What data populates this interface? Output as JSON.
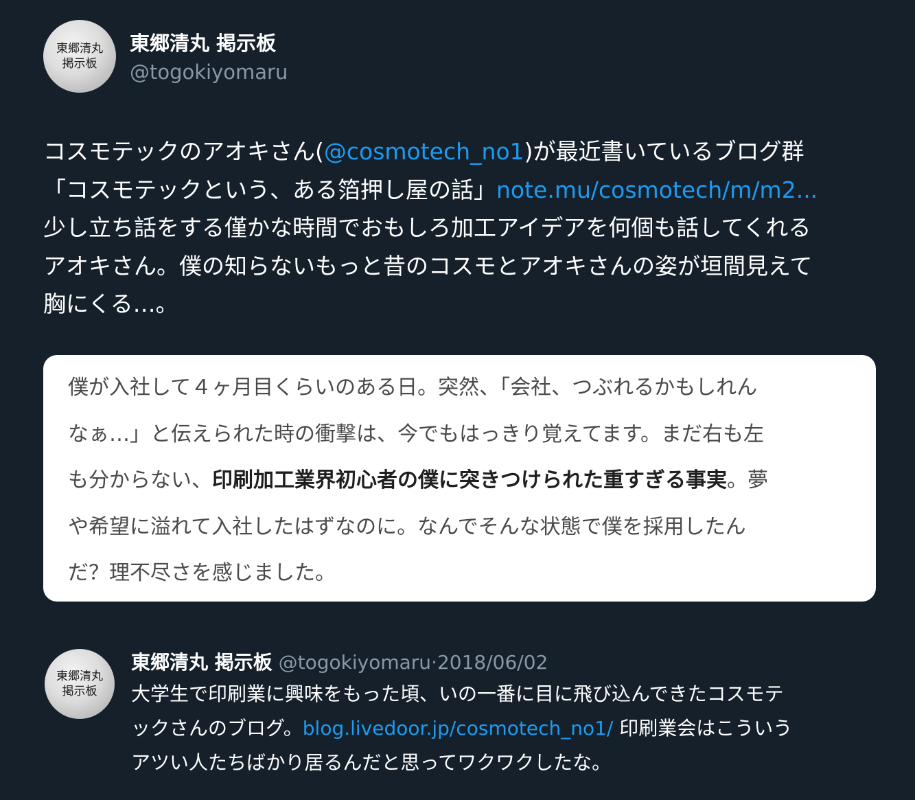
{
  "tweet": {
    "avatar_text": [
      "東郷清丸",
      "掲示板"
    ],
    "display_name": "東郷清丸 掲示板",
    "handle": "@togokiyomaru",
    "lines": [
      {
        "pre": "コスモテックのアオキさん(",
        "link": "@cosmotech_no1",
        "post": ")が最近書いているブログ群"
      },
      {
        "pre": "「コスモテックという、ある箔押し屋の話」",
        "link": "note.mu/cosmotech/m/m2...",
        "post": ""
      },
      {
        "pre": "少し立ち話をする僅かな時間でおもしろ加工アイデアを何個も話してくれる",
        "link": "",
        "post": ""
      },
      {
        "pre": "アオキさん。僕の知らないもっと昔のコスモとアオキさんの姿が垣間見えて",
        "link": "",
        "post": ""
      },
      {
        "pre": "胸にくる…。",
        "link": "",
        "post": ""
      }
    ]
  },
  "card": {
    "lines": [
      {
        "pre": "僕が入社して４ヶ月目くらいのある日。突然、「会社、つぶれるかもしれん",
        "bold": "",
        "post": ""
      },
      {
        "pre": "なぁ…」と伝えられた時の衝撃は、今でもはっきり覚えてます。まだ右も左",
        "bold": "",
        "post": ""
      },
      {
        "pre": "も分からない、",
        "bold": "印刷加工業界初心者の僕に突きつけられた重すぎる事実",
        "post": "。夢"
      },
      {
        "pre": "や希望に溢れて入社したはずなのに。なんでそんな状態で僕を採用したん",
        "bold": "",
        "post": ""
      },
      {
        "pre": "だ？理不尽さを感じました。",
        "bold": "",
        "post": ""
      }
    ]
  },
  "quoted": {
    "avatar_text": [
      "東郷清丸",
      "掲示板"
    ],
    "display_name": "東郷清丸 掲示板",
    "handle": "@togokiyomaru",
    "separator": "·",
    "date": "2018/06/02",
    "lines": [
      {
        "pre": "大学生で印刷業に興味をもった頃、いの一番に目に飛び込んできたコスモテ",
        "link": "",
        "post": ""
      },
      {
        "pre": "ックさんのブログ。",
        "link": "blog.livedoor.jp/cosmotech_no1/",
        "post": " 印刷業会はこういう"
      },
      {
        "pre": "アツい人たちばかり居るんだと思ってワクワクしたな。",
        "link": "",
        "post": ""
      }
    ]
  },
  "colors": {
    "background": "#15202b",
    "link": "#1d9bf0",
    "secondary_text": "#8899a6"
  }
}
